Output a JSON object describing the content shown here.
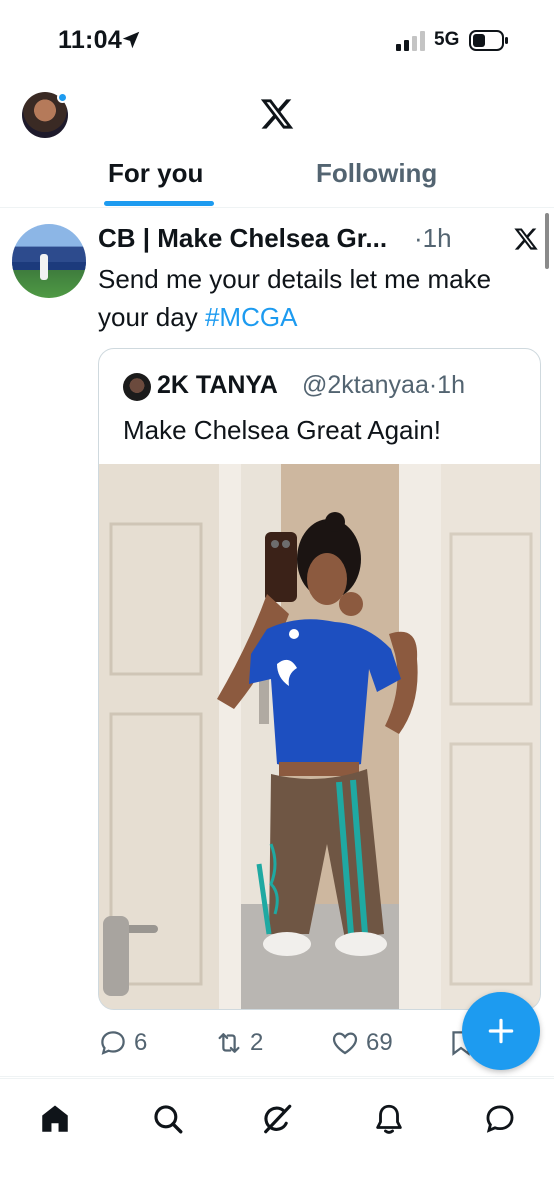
{
  "status_bar": {
    "time": "11:04",
    "network": "5G",
    "icons": [
      "location-arrow-icon",
      "signal-icon",
      "battery-icon"
    ]
  },
  "header": {
    "logo": "x-logo-icon",
    "tabs": [
      {
        "label": "For you",
        "active": true
      },
      {
        "label": "Following",
        "active": false
      }
    ],
    "accent_color": "#1d9bf0"
  },
  "tweet": {
    "author_name": "CB | Make Chelsea Gr...",
    "separator": "·",
    "time": "1h",
    "text_main": "Send me your details let me make your day ",
    "hashtag": "#MCGA",
    "quote": {
      "author_name": "2K TANYA",
      "handle": "@2ktanyaa",
      "separator": "·",
      "time": "1h",
      "text": "Make Chelsea Great Again!",
      "photo": "mirror-selfie-chelsea-jersey"
    },
    "actions": {
      "replies": "6",
      "retweets": "2",
      "likes": "69"
    }
  },
  "fab": {
    "icon": "plus-icon",
    "color": "#1d9bf0"
  },
  "bottom_nav": [
    "home-icon",
    "search-icon",
    "grok-icon",
    "notifications-icon",
    "messages-icon"
  ]
}
